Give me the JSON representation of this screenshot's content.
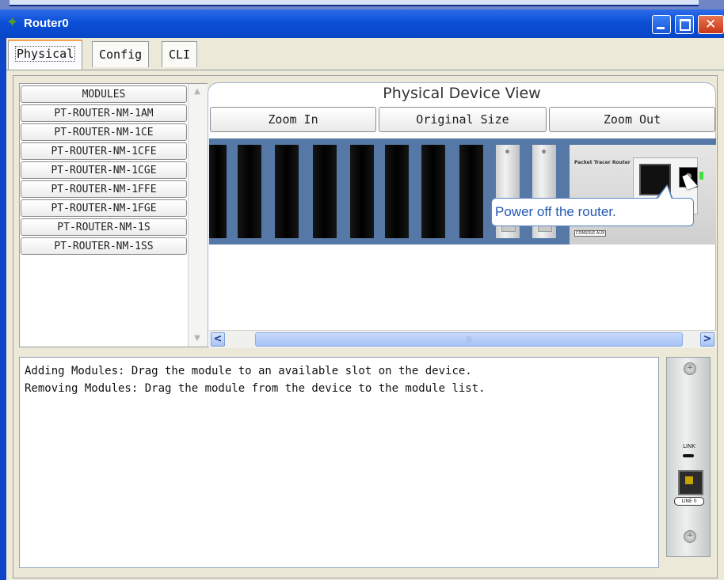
{
  "window": {
    "title": "Router0"
  },
  "tabs": [
    {
      "label": "Physical",
      "active": true
    },
    {
      "label": "Config",
      "active": false
    },
    {
      "label": "CLI",
      "active": false
    }
  ],
  "modules": {
    "header": "MODULES",
    "items": [
      "PT-ROUTER-NM-1AM",
      "PT-ROUTER-NM-1CE",
      "PT-ROUTER-NM-1CFE",
      "PT-ROUTER-NM-1CGE",
      "PT-ROUTER-NM-1FFE",
      "PT-ROUTER-NM-1FGE",
      "PT-ROUTER-NM-1S",
      "PT-ROUTER-NM-1SS"
    ]
  },
  "device_view": {
    "title": "Physical Device View",
    "zoom_in": "Zoom In",
    "original_size": "Original Size",
    "zoom_out": "Zoom Out",
    "device_label": "Packet Tracer Router",
    "ports_label": "CONSOLE  AUX",
    "tooltip": "Power off the router."
  },
  "info": {
    "line1": "Adding Modules: Drag the module to an available slot on the device.",
    "line2": "Removing Modules: Drag the module from the device to the module list."
  },
  "module_preview": {
    "link_label": "LINK",
    "port_label": "LINE 0"
  },
  "icons": {
    "app": "router-icon",
    "minimize": "minimize-icon",
    "maximize": "maximize-icon",
    "close": "close-icon"
  },
  "colors": {
    "titlebar": "#0a4fd6",
    "tab_accent": "#f4a24c",
    "device_body": "#5578a6",
    "tooltip_text": "#2457b3",
    "power_led": "#3ce23c"
  }
}
